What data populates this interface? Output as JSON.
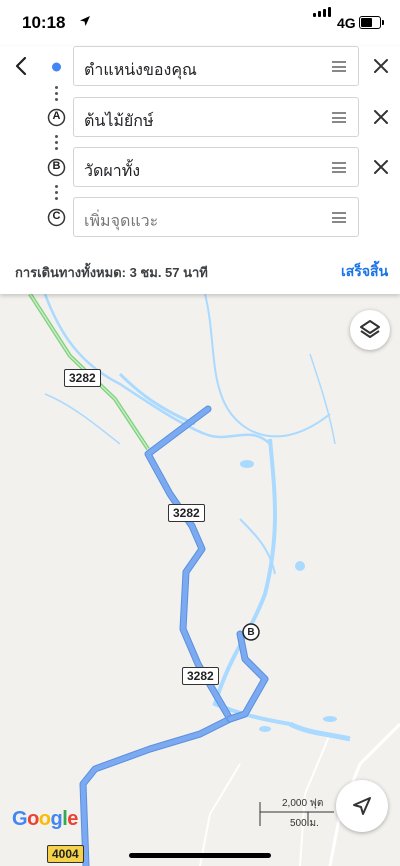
{
  "status_bar": {
    "time": "10:18",
    "network": "4G"
  },
  "directions": {
    "origin": {
      "label": "ตำแหน่งของคุณ"
    },
    "stops": [
      {
        "marker": "A",
        "label": "ต้นไม้ยักษ์"
      },
      {
        "marker": "B",
        "label": "วัดผาทั้ง"
      }
    ],
    "add_stop": {
      "marker": "C",
      "placeholder": "เพิ่มจุดแวะ"
    },
    "total_time": "การเดินทางทั้งหมด: 3 ชม. 57 นาที",
    "done_label": "เสร็จสิ้น"
  },
  "map": {
    "road_labels": [
      "3282",
      "3282",
      "3282",
      "4004"
    ],
    "destination_marker": "B",
    "scale_imperial": "2,000 ฟุต",
    "scale_metric": "500 ม.",
    "attribution": "Google",
    "colors": {
      "route": "#7baaf0",
      "water": "#aadaff",
      "land": "#f2f1ed",
      "green_road": "#7dd17d"
    }
  }
}
